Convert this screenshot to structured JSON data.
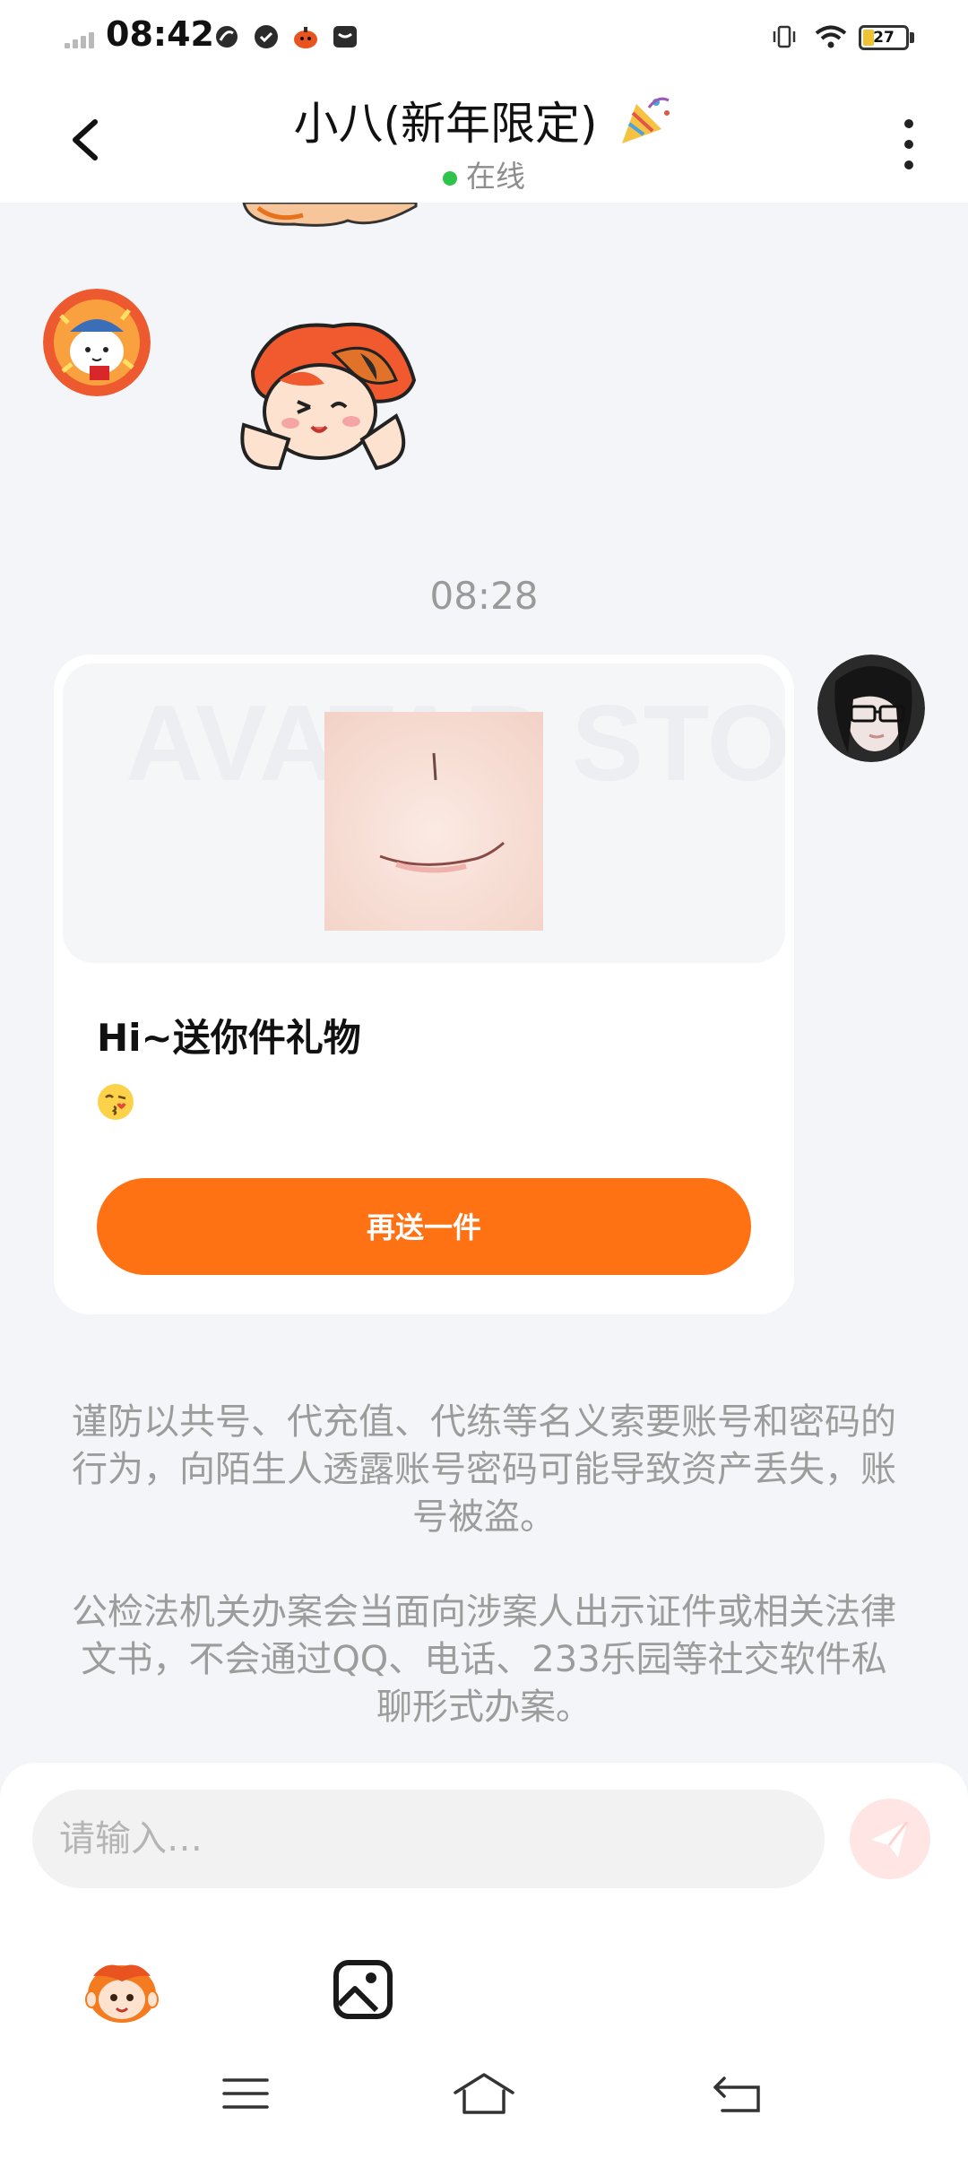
{
  "status_bar": {
    "time": "08:42",
    "battery": "27",
    "battery_level": 0.27,
    "icons": [
      "signal-icon",
      "swirl-icon",
      "check-badge-icon",
      "pumpkin-icon",
      "message-icon",
      "vibrate-icon",
      "wifi-icon",
      "battery-icon"
    ]
  },
  "header": {
    "title": "小八(新年限定)",
    "status": "在线",
    "status_color": "#2ec44b"
  },
  "chat": {
    "timestamp": "08:28",
    "gift_card": {
      "image_watermark": "AVATAR STORE",
      "title": "Hi~送你件礼物",
      "emoji": "😘",
      "button_label": "再送一件",
      "accent": "#ff7214"
    },
    "notices": [
      "谨防以共号、代充值、代练等名义索要账号和密码的行为，向陌生人透露账号密码可能导致资产丢失，账号被盗。",
      "公检法机关办案会当面向涉案人出示证件或相关法律文书，不会通过QQ、电话、233乐园等社交软件私聊形式办案。"
    ]
  },
  "input": {
    "placeholder": "请输入…"
  },
  "toolbar": {
    "items": [
      "emoji-sticker-icon",
      "image-icon"
    ]
  },
  "nav": {
    "items": [
      "menu-icon",
      "home-icon",
      "back-icon"
    ]
  }
}
